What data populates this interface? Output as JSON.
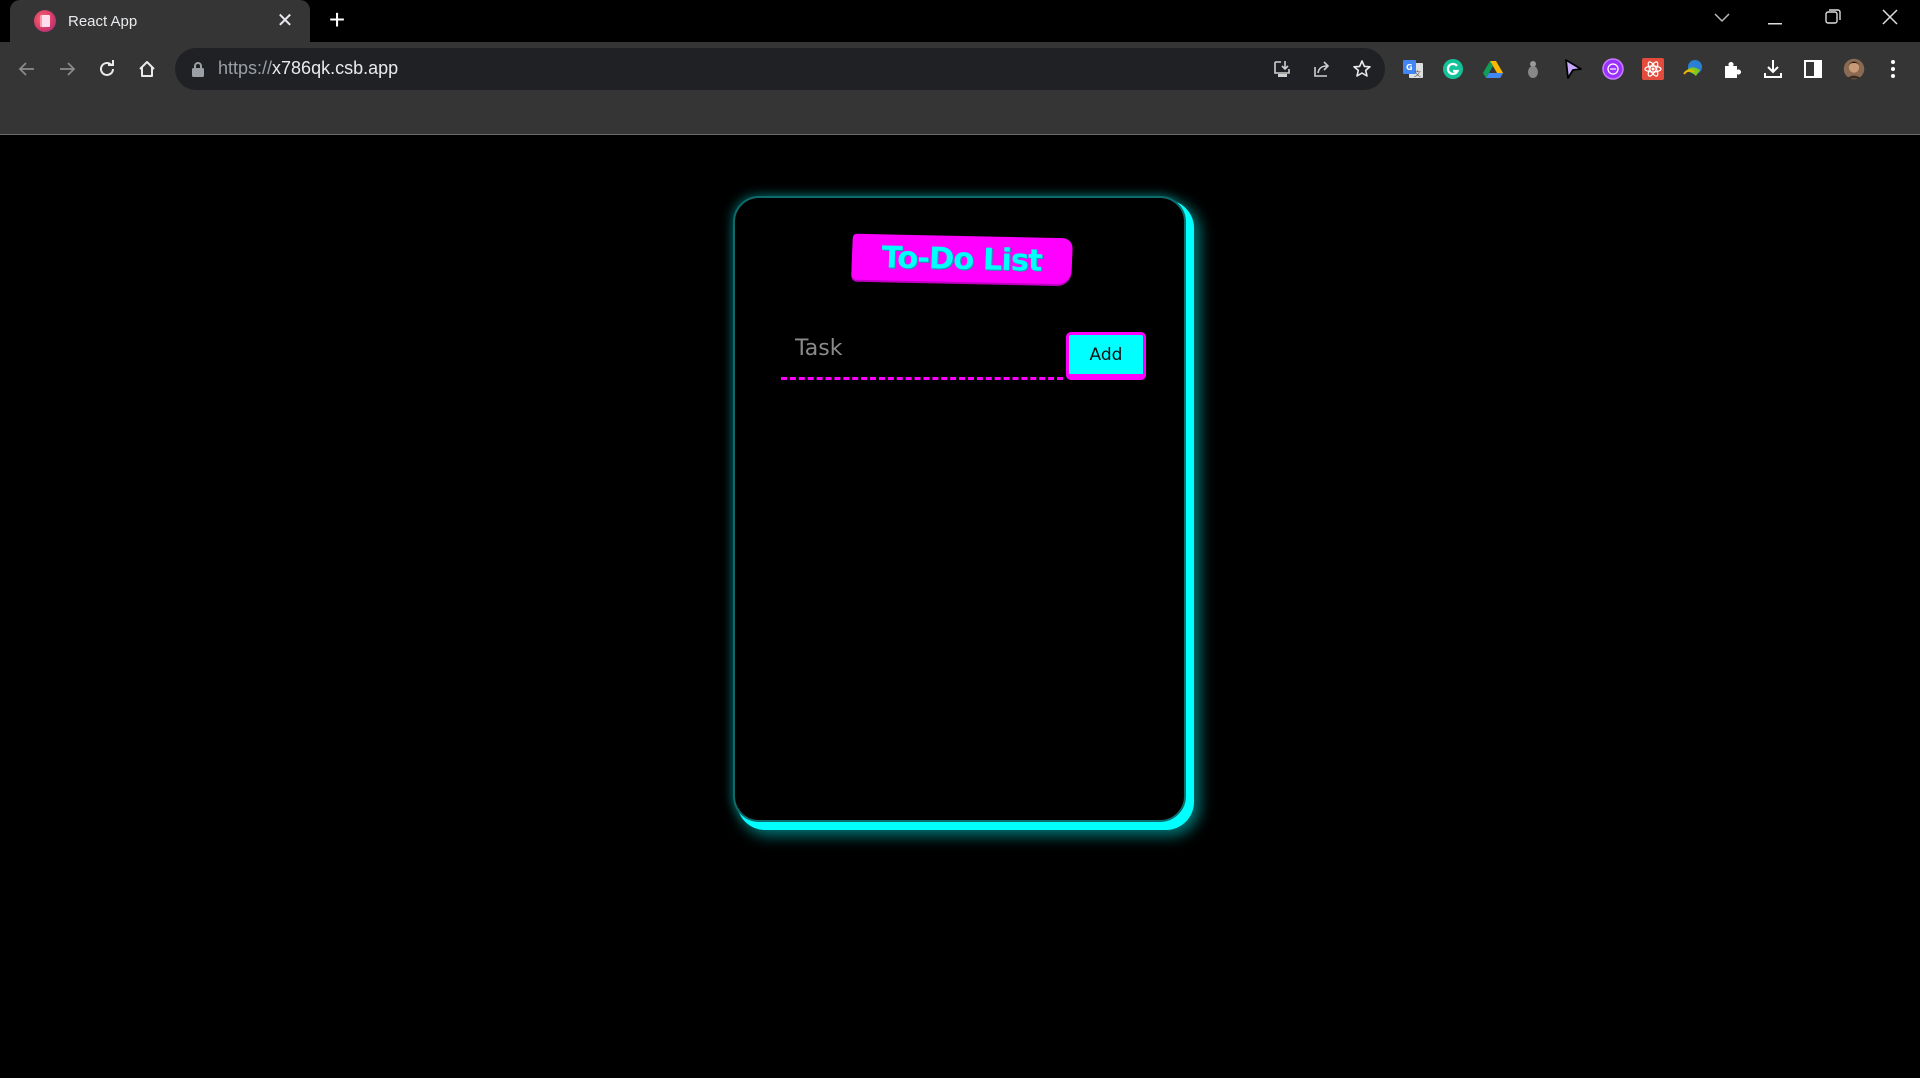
{
  "browser": {
    "tab": {
      "title": "React App",
      "favicon": "react-app-favicon",
      "close_icon": "close-icon"
    },
    "new_tab_icon": "plus-icon",
    "window_controls": [
      {
        "name": "tab-search",
        "glyph": "⌄"
      },
      {
        "name": "minimize",
        "glyph": "—"
      },
      {
        "name": "restore",
        "glyph": "❐"
      },
      {
        "name": "close",
        "glyph": "✕"
      }
    ],
    "nav": {
      "back_icon": "arrow-left-icon",
      "forward_icon": "arrow-right-icon",
      "reload_icon": "reload-icon",
      "home_icon": "home-icon"
    },
    "address_bar": {
      "scheme": "https://",
      "host": "x786qk.csb.app"
    },
    "omnibox_actions": [
      "install-app-icon",
      "share-icon",
      "bookmark-star-icon"
    ],
    "extensions": [
      "google-translate-icon",
      "grammarly-icon",
      "google-drive-icon",
      "bug-extension-icon",
      "cursor-extension-icon",
      "purple-chat-extension-icon",
      "react-devtools-icon",
      "download-manager-icon",
      "extensions-puzzle-icon",
      "downloads-icon",
      "side-panel-icon",
      "profile-avatar",
      "menu-kebab-icon"
    ]
  },
  "app": {
    "title": "To-Do List",
    "input": {
      "placeholder": "Task",
      "value": ""
    },
    "add_button": "Add",
    "tasks": [],
    "colors": {
      "accent_cyan": "#00ffff",
      "accent_magenta": "#ff00ff",
      "background": "#000000"
    }
  }
}
